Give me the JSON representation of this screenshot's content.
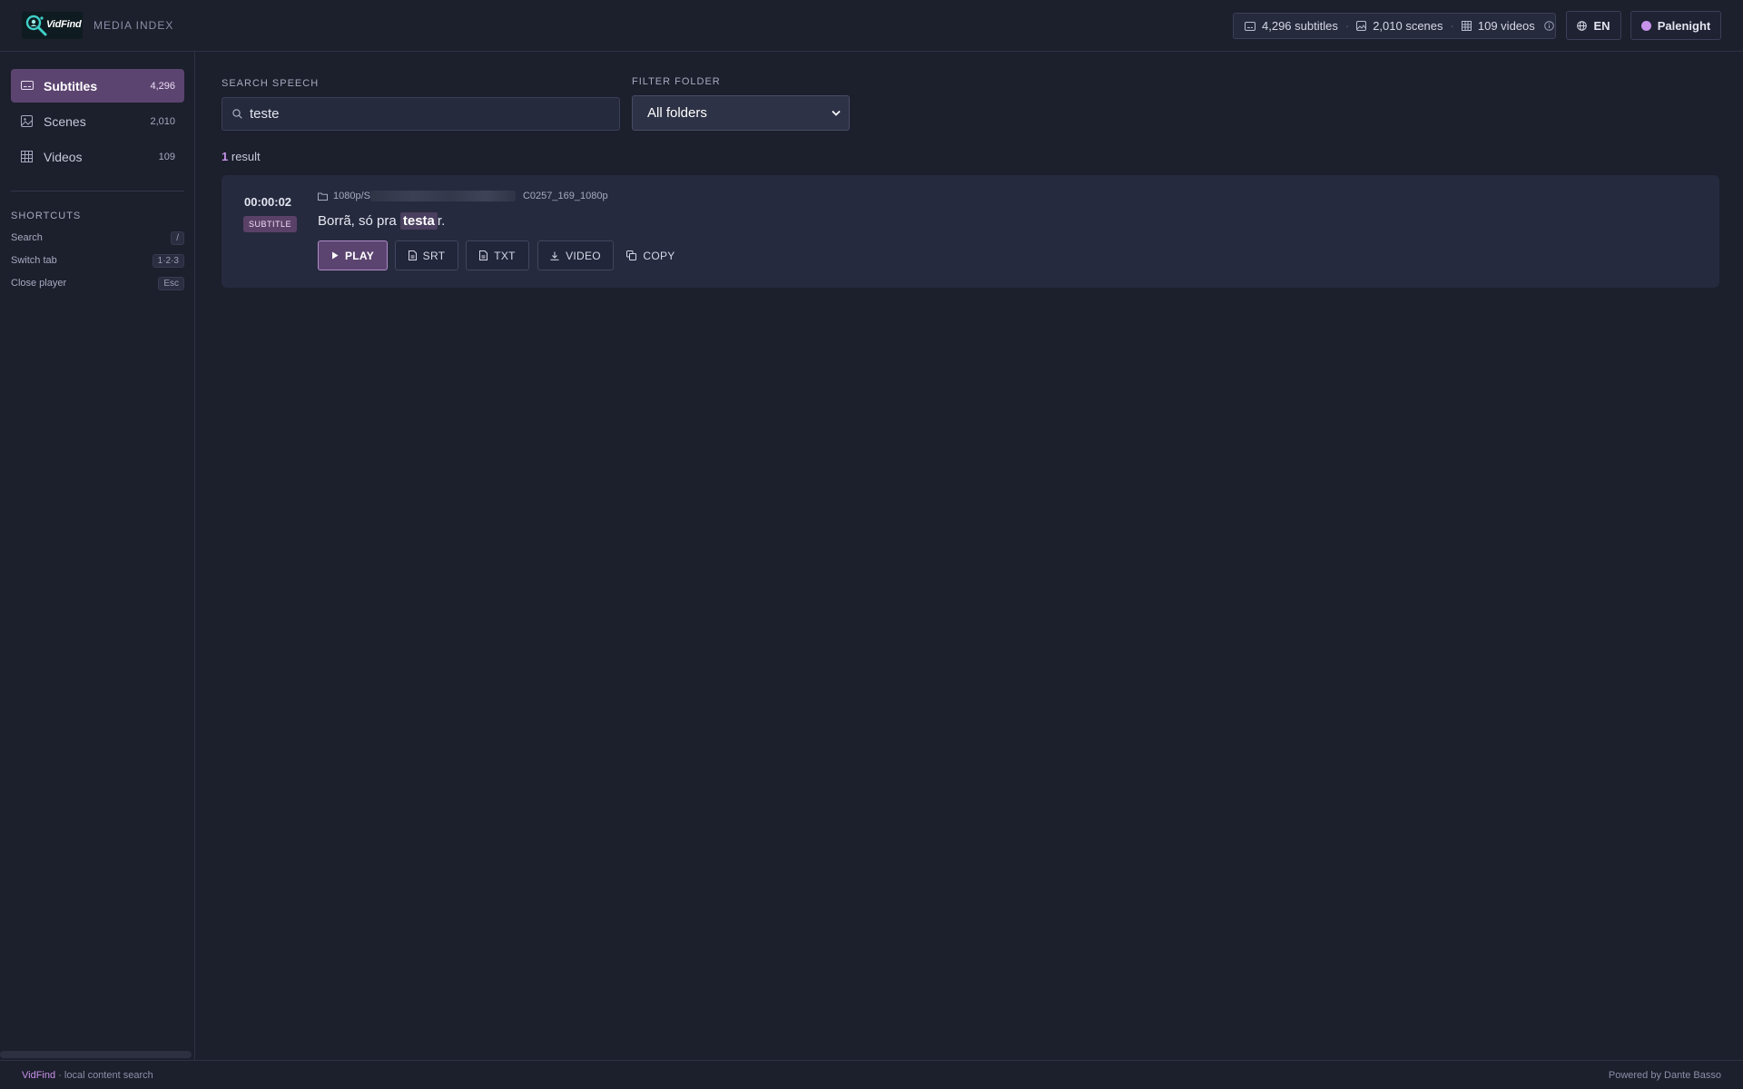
{
  "header": {
    "logo_text": "VidFind",
    "subtitle": "MEDIA INDEX",
    "stats": {
      "subtitles": "4,296 subtitles",
      "scenes": "2,010 scenes",
      "videos": "109 videos"
    },
    "language": "EN",
    "theme": "Palenight",
    "theme_color": "#c792ea"
  },
  "sidebar": {
    "items": [
      {
        "label": "Subtitles",
        "count": "4,296",
        "icon": "subtitles-icon",
        "active": true
      },
      {
        "label": "Scenes",
        "count": "2,010",
        "icon": "image-icon",
        "active": false
      },
      {
        "label": "Videos",
        "count": "109",
        "icon": "grid-icon",
        "active": false
      }
    ],
    "shortcuts_title": "SHORTCUTS",
    "shortcuts": [
      {
        "label": "Search",
        "key": "/"
      },
      {
        "label": "Switch tab",
        "key": "1·2·3"
      },
      {
        "label": "Close player",
        "key": "Esc"
      }
    ]
  },
  "search": {
    "label": "SEARCH SPEECH",
    "value": "teste",
    "icon": "search-icon"
  },
  "filter": {
    "label": "FILTER FOLDER",
    "selected": "All folders"
  },
  "results": {
    "count": "1",
    "count_suffix": "result",
    "items": [
      {
        "timecode": "00:00:02",
        "type": "SUBTITLE",
        "path_prefix": "1080p/S",
        "path_suffix": "C0257_169_1080p",
        "text_before": "Borrã, só pra ",
        "text_highlight": "testa",
        "text_after": "r.",
        "actions": {
          "play": "PLAY",
          "srt": "SRT",
          "txt": "TXT",
          "video": "VIDEO",
          "copy": "COPY"
        }
      }
    ]
  },
  "footer": {
    "brand": "VidFind",
    "tagline": " · local content search",
    "powered_by": "Powered by Dante Basso"
  },
  "colors": {
    "accent": "#c792ea",
    "background": "#1c1f2c",
    "card": "#262a3e",
    "active_nav": "#5c4470"
  }
}
